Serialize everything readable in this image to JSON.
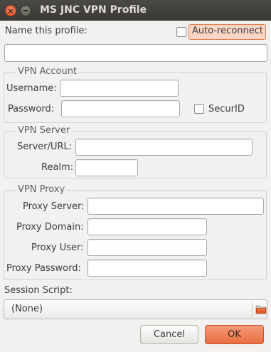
{
  "window": {
    "title": "MS JNC VPN Profile"
  },
  "profile": {
    "name_label": "Name this profile:",
    "name_value": "",
    "auto_reconnect_label": "Auto-reconnect",
    "auto_reconnect_checked": false
  },
  "vpn_account": {
    "title": "VPN Account",
    "username_label": "Username:",
    "username_value": "",
    "password_label": "Password:",
    "password_value": "",
    "securid_label": "SecurID",
    "securid_checked": false
  },
  "vpn_server": {
    "title": "VPN Server",
    "server_label": "Server/URL:",
    "server_value": "",
    "realm_label": "Realm:",
    "realm_value": ""
  },
  "vpn_proxy": {
    "title": "VPN Proxy",
    "server_label": "Proxy Server:",
    "domain_label": "Proxy Domain:",
    "user_label": "Proxy User:",
    "password_label": "Proxy Password:"
  },
  "session": {
    "label": "Session Script:",
    "selected": "(None)"
  },
  "buttons": {
    "cancel": "Cancel",
    "ok": "OK"
  },
  "colors": {
    "accent": "#e86d40",
    "titlebar": "#3c3b37"
  }
}
